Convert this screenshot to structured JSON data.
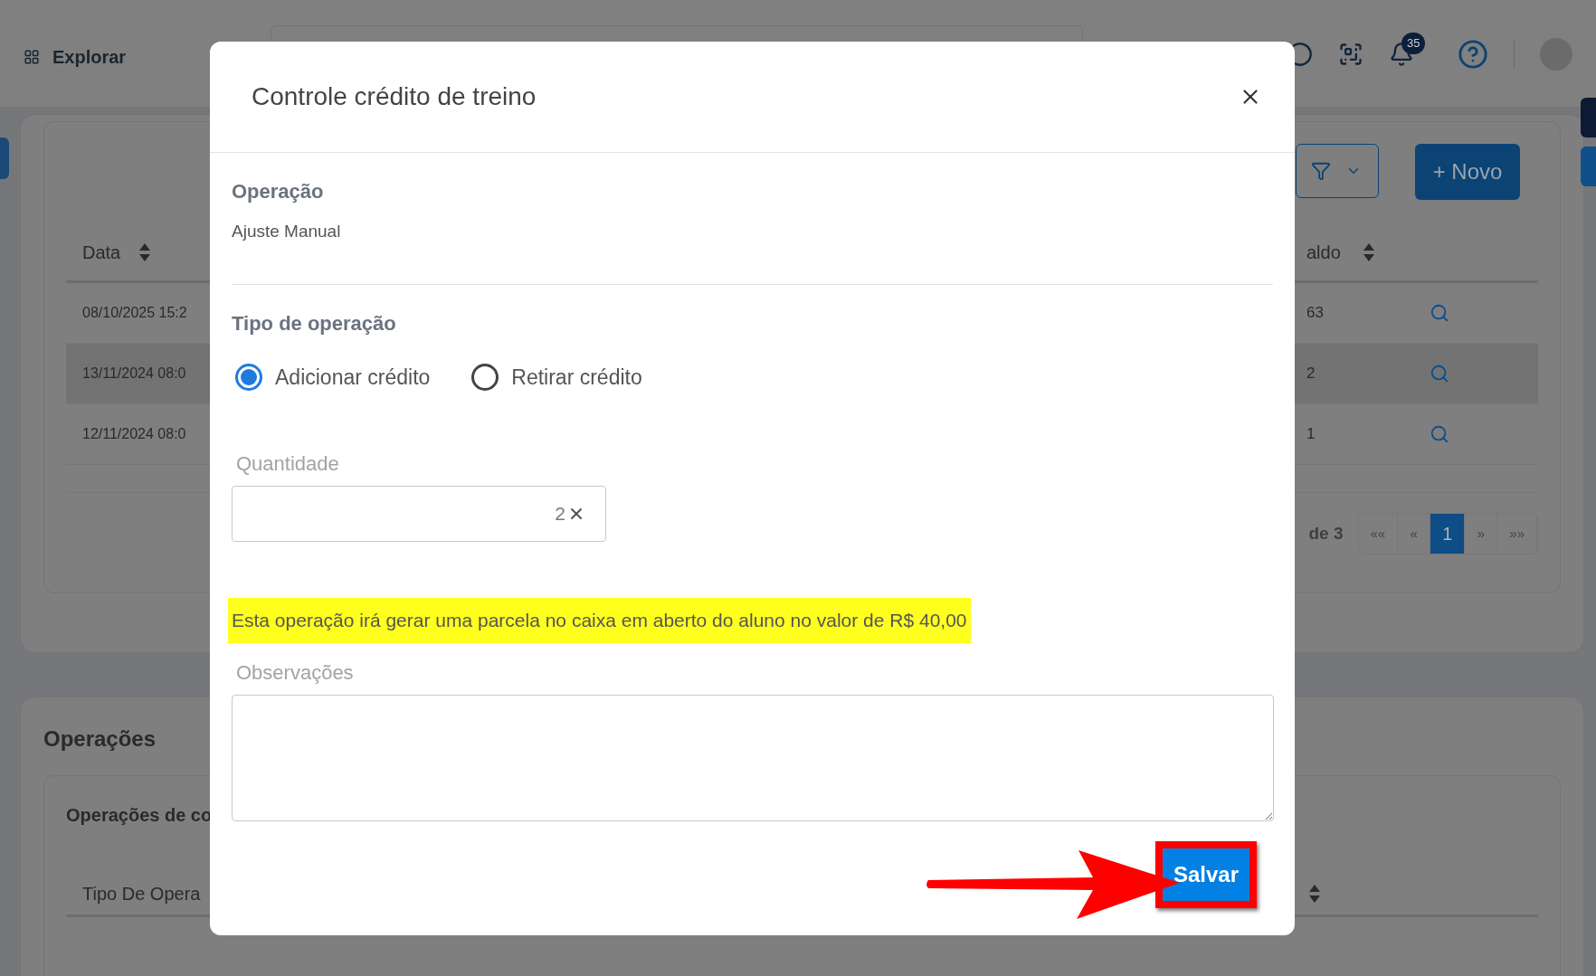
{
  "top_bar": {
    "explore_label": "Explorar",
    "notification_count": "35"
  },
  "history": {
    "new_button": "+ Novo",
    "columns": [
      {
        "label": "Data"
      },
      {
        "label": "aldo"
      }
    ],
    "rows": [
      {
        "date": "08/10/2025 15:2",
        "balance": "63",
        "highlighted": false
      },
      {
        "date": "13/11/2024 08:0",
        "balance": "2",
        "highlighted": true
      },
      {
        "date": "12/11/2024 08:0",
        "balance": "1",
        "highlighted": false
      }
    ],
    "pagination": {
      "summary": "de 3",
      "pages": [
        {
          "label": "««",
          "selected": false
        },
        {
          "label": "«",
          "selected": false
        },
        {
          "label": "1",
          "selected": true
        },
        {
          "label": "»",
          "selected": false
        },
        {
          "label": "»»",
          "selected": false
        }
      ]
    }
  },
  "operations": {
    "title": "Operações",
    "subtitle": "Operações de co",
    "column": "Tipo De Opera"
  },
  "modal": {
    "title": "Controle crédito de treino",
    "operation_label": "Operação",
    "operation_value": "Ajuste Manual",
    "type_label": "Tipo de operação",
    "types": [
      {
        "label": "Adicionar crédito",
        "selected": true
      },
      {
        "label": "Retirar crédito",
        "selected": false
      }
    ],
    "quantity": {
      "label": "Quantidade",
      "value": "2"
    },
    "notice": "Esta operação irá gerar uma parcela no caixa em aberto do aluno no valor de R$ 40,00",
    "notes": {
      "label": "Observações"
    },
    "save_button": "Salvar"
  }
}
